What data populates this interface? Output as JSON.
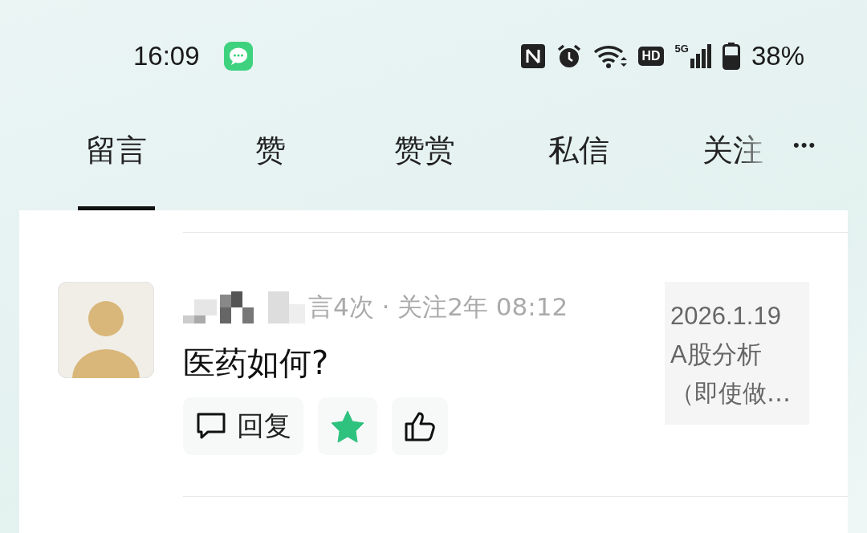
{
  "status_bar": {
    "time": "16:09",
    "hd": "HD",
    "network": "5G",
    "battery": "38%"
  },
  "tabs": [
    {
      "label": "留言",
      "selected": true
    },
    {
      "label": "赞",
      "selected": false
    },
    {
      "label": "赞赏",
      "selected": false
    },
    {
      "label": "私信",
      "selected": false
    },
    {
      "label": "关注",
      "selected": false
    }
  ],
  "more": "•••",
  "comment": {
    "meta": "言4次 · 关注2年 08:12",
    "text": "医药如何?",
    "reply": "回复",
    "starred": true,
    "liked": false,
    "article": [
      "2026.1.19",
      "A股分析",
      "（即使做…"
    ]
  }
}
